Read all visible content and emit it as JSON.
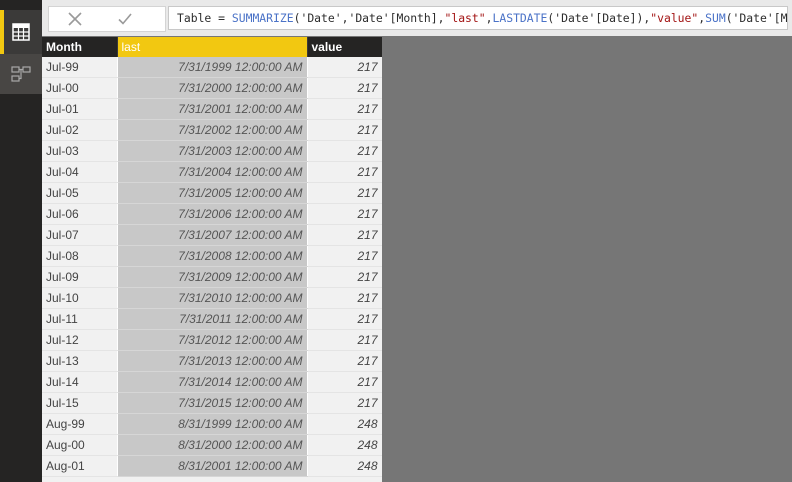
{
  "formula_bar": {
    "tokens": [
      {
        "text": "Table = ",
        "kind": "kw"
      },
      {
        "text": "SUMMARIZE",
        "kind": "fn"
      },
      {
        "text": "('Date','Date'[Month],",
        "kind": "kw"
      },
      {
        "text": "\"last\"",
        "kind": "str"
      },
      {
        "text": ",",
        "kind": "kw"
      },
      {
        "text": "LASTDATE",
        "kind": "fn"
      },
      {
        "text": "('Date'[Date]),",
        "kind": "kw"
      },
      {
        "text": "\"value\"",
        "kind": "str"
      },
      {
        "text": ",",
        "kind": "kw"
      },
      {
        "text": "SUM",
        "kind": "fn"
      },
      {
        "text": "('Date'[MonthNo]))",
        "kind": "kw"
      }
    ]
  },
  "colors": {
    "accent": "#f2c811",
    "rail": "#252423",
    "function": "#4a72c7",
    "string": "#a31515"
  },
  "icons": {
    "data_view": "table-grid-icon",
    "relationships_view": "relationships-icon",
    "cancel": "x-icon",
    "confirm": "check-icon"
  },
  "table": {
    "headers": [
      "Month",
      "last",
      "value"
    ],
    "selected_column": 1,
    "rows": [
      [
        "Jul-99",
        "7/31/1999 12:00:00 AM",
        "217"
      ],
      [
        "Jul-00",
        "7/31/2000 12:00:00 AM",
        "217"
      ],
      [
        "Jul-01",
        "7/31/2001 12:00:00 AM",
        "217"
      ],
      [
        "Jul-02",
        "7/31/2002 12:00:00 AM",
        "217"
      ],
      [
        "Jul-03",
        "7/31/2003 12:00:00 AM",
        "217"
      ],
      [
        "Jul-04",
        "7/31/2004 12:00:00 AM",
        "217"
      ],
      [
        "Jul-05",
        "7/31/2005 12:00:00 AM",
        "217"
      ],
      [
        "Jul-06",
        "7/31/2006 12:00:00 AM",
        "217"
      ],
      [
        "Jul-07",
        "7/31/2007 12:00:00 AM",
        "217"
      ],
      [
        "Jul-08",
        "7/31/2008 12:00:00 AM",
        "217"
      ],
      [
        "Jul-09",
        "7/31/2009 12:00:00 AM",
        "217"
      ],
      [
        "Jul-10",
        "7/31/2010 12:00:00 AM",
        "217"
      ],
      [
        "Jul-11",
        "7/31/2011 12:00:00 AM",
        "217"
      ],
      [
        "Jul-12",
        "7/31/2012 12:00:00 AM",
        "217"
      ],
      [
        "Jul-13",
        "7/31/2013 12:00:00 AM",
        "217"
      ],
      [
        "Jul-14",
        "7/31/2014 12:00:00 AM",
        "217"
      ],
      [
        "Jul-15",
        "7/31/2015 12:00:00 AM",
        "217"
      ],
      [
        "Aug-99",
        "8/31/1999 12:00:00 AM",
        "248"
      ],
      [
        "Aug-00",
        "8/31/2000 12:00:00 AM",
        "248"
      ],
      [
        "Aug-01",
        "8/31/2001 12:00:00 AM",
        "248"
      ]
    ]
  }
}
